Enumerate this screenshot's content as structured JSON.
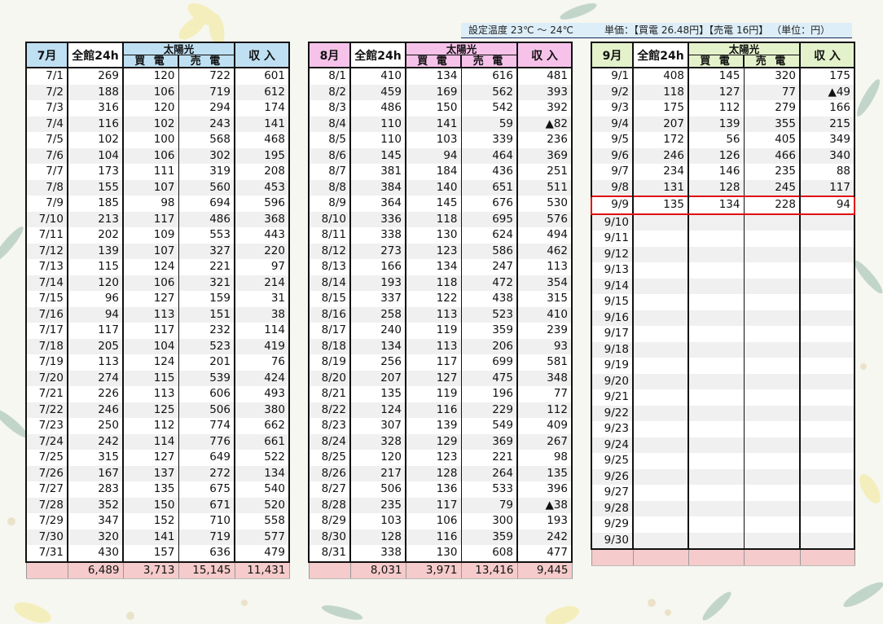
{
  "note": {
    "temp": "設定温度 23℃ ～ 24℃",
    "price": "単価：【買電 26.48円】【売電 16円】 （単位：円）"
  },
  "headers": {
    "all": "全館24h",
    "solar": "太陽光",
    "buy": "買 電",
    "sell": "売 電",
    "income": "収 入"
  },
  "colors": {
    "jul_header": "#bfe0f2",
    "aug_header": "#f6c2ea",
    "sep_header": "#e4f2cc",
    "total_row": "#f6cbcb",
    "highlight": "#e01010"
  },
  "highlight_row": {
    "month": "9月",
    "date": "9/9"
  },
  "months": [
    {
      "label": "7月",
      "rows": [
        [
          "7/1",
          "269",
          "120",
          "722",
          "601"
        ],
        [
          "7/2",
          "188",
          "106",
          "719",
          "612"
        ],
        [
          "7/3",
          "316",
          "120",
          "294",
          "174"
        ],
        [
          "7/4",
          "116",
          "102",
          "243",
          "141"
        ],
        [
          "7/5",
          "102",
          "100",
          "568",
          "468"
        ],
        [
          "7/6",
          "104",
          "106",
          "302",
          "195"
        ],
        [
          "7/7",
          "173",
          "111",
          "319",
          "208"
        ],
        [
          "7/8",
          "155",
          "107",
          "560",
          "453"
        ],
        [
          "7/9",
          "185",
          "98",
          "694",
          "596"
        ],
        [
          "7/10",
          "213",
          "117",
          "486",
          "368"
        ],
        [
          "7/11",
          "202",
          "109",
          "553",
          "443"
        ],
        [
          "7/12",
          "139",
          "107",
          "327",
          "220"
        ],
        [
          "7/13",
          "115",
          "124",
          "221",
          "97"
        ],
        [
          "7/14",
          "120",
          "106",
          "321",
          "214"
        ],
        [
          "7/15",
          "96",
          "127",
          "159",
          "31"
        ],
        [
          "7/16",
          "94",
          "113",
          "151",
          "38"
        ],
        [
          "7/17",
          "117",
          "117",
          "232",
          "114"
        ],
        [
          "7/18",
          "205",
          "104",
          "523",
          "419"
        ],
        [
          "7/19",
          "113",
          "124",
          "201",
          "76"
        ],
        [
          "7/20",
          "274",
          "115",
          "539",
          "424"
        ],
        [
          "7/21",
          "226",
          "113",
          "606",
          "493"
        ],
        [
          "7/22",
          "246",
          "125",
          "506",
          "380"
        ],
        [
          "7/23",
          "250",
          "112",
          "774",
          "662"
        ],
        [
          "7/24",
          "242",
          "114",
          "776",
          "661"
        ],
        [
          "7/25",
          "315",
          "127",
          "649",
          "522"
        ],
        [
          "7/26",
          "167",
          "137",
          "272",
          "134"
        ],
        [
          "7/27",
          "283",
          "135",
          "675",
          "540"
        ],
        [
          "7/28",
          "352",
          "150",
          "671",
          "520"
        ],
        [
          "7/29",
          "347",
          "152",
          "710",
          "558"
        ],
        [
          "7/30",
          "320",
          "141",
          "719",
          "577"
        ],
        [
          "7/31",
          "430",
          "157",
          "636",
          "479"
        ]
      ],
      "total": [
        "",
        "6,489",
        "3,713",
        "15,145",
        "11,431"
      ]
    },
    {
      "label": "8月",
      "rows": [
        [
          "8/1",
          "410",
          "134",
          "616",
          "481"
        ],
        [
          "8/2",
          "459",
          "169",
          "562",
          "393"
        ],
        [
          "8/3",
          "486",
          "150",
          "542",
          "392"
        ],
        [
          "8/4",
          "110",
          "141",
          "59",
          "▲82"
        ],
        [
          "8/5",
          "110",
          "103",
          "339",
          "236"
        ],
        [
          "8/6",
          "145",
          "94",
          "464",
          "369"
        ],
        [
          "8/7",
          "381",
          "184",
          "436",
          "251"
        ],
        [
          "8/8",
          "384",
          "140",
          "651",
          "511"
        ],
        [
          "8/9",
          "364",
          "145",
          "676",
          "530"
        ],
        [
          "8/10",
          "336",
          "118",
          "695",
          "576"
        ],
        [
          "8/11",
          "338",
          "130",
          "624",
          "494"
        ],
        [
          "8/12",
          "273",
          "123",
          "586",
          "462"
        ],
        [
          "8/13",
          "166",
          "134",
          "247",
          "113"
        ],
        [
          "8/14",
          "193",
          "118",
          "472",
          "354"
        ],
        [
          "8/15",
          "337",
          "122",
          "438",
          "315"
        ],
        [
          "8/16",
          "258",
          "113",
          "523",
          "410"
        ],
        [
          "8/17",
          "240",
          "119",
          "359",
          "239"
        ],
        [
          "8/18",
          "134",
          "113",
          "206",
          "93"
        ],
        [
          "8/19",
          "256",
          "117",
          "699",
          "581"
        ],
        [
          "8/20",
          "207",
          "127",
          "475",
          "348"
        ],
        [
          "8/21",
          "135",
          "119",
          "196",
          "77"
        ],
        [
          "8/22",
          "124",
          "116",
          "229",
          "112"
        ],
        [
          "8/23",
          "307",
          "139",
          "549",
          "409"
        ],
        [
          "8/24",
          "328",
          "129",
          "369",
          "267"
        ],
        [
          "8/25",
          "120",
          "123",
          "221",
          "98"
        ],
        [
          "8/26",
          "217",
          "128",
          "264",
          "135"
        ],
        [
          "8/27",
          "506",
          "136",
          "533",
          "396"
        ],
        [
          "8/28",
          "235",
          "117",
          "79",
          "▲38"
        ],
        [
          "8/29",
          "103",
          "106",
          "300",
          "193"
        ],
        [
          "8/30",
          "128",
          "116",
          "359",
          "242"
        ],
        [
          "8/31",
          "338",
          "130",
          "608",
          "477"
        ]
      ],
      "total": [
        "",
        "8,031",
        "3,971",
        "13,416",
        "9,445"
      ]
    },
    {
      "label": "9月",
      "rows": [
        [
          "9/1",
          "408",
          "145",
          "320",
          "175"
        ],
        [
          "9/2",
          "118",
          "127",
          "77",
          "▲49"
        ],
        [
          "9/3",
          "175",
          "112",
          "279",
          "166"
        ],
        [
          "9/4",
          "207",
          "139",
          "355",
          "215"
        ],
        [
          "9/5",
          "172",
          "56",
          "405",
          "349"
        ],
        [
          "9/6",
          "246",
          "126",
          "466",
          "340"
        ],
        [
          "9/7",
          "234",
          "146",
          "235",
          "88"
        ],
        [
          "9/8",
          "131",
          "128",
          "245",
          "117"
        ],
        [
          "9/9",
          "135",
          "134",
          "228",
          "94"
        ],
        [
          "9/10",
          "",
          "",
          "",
          ""
        ],
        [
          "9/11",
          "",
          "",
          "",
          ""
        ],
        [
          "9/12",
          "",
          "",
          "",
          ""
        ],
        [
          "9/13",
          "",
          "",
          "",
          ""
        ],
        [
          "9/14",
          "",
          "",
          "",
          ""
        ],
        [
          "9/15",
          "",
          "",
          "",
          ""
        ],
        [
          "9/16",
          "",
          "",
          "",
          ""
        ],
        [
          "9/17",
          "",
          "",
          "",
          ""
        ],
        [
          "9/18",
          "",
          "",
          "",
          ""
        ],
        [
          "9/19",
          "",
          "",
          "",
          ""
        ],
        [
          "9/20",
          "",
          "",
          "",
          ""
        ],
        [
          "9/21",
          "",
          "",
          "",
          ""
        ],
        [
          "9/22",
          "",
          "",
          "",
          ""
        ],
        [
          "9/23",
          "",
          "",
          "",
          ""
        ],
        [
          "9/24",
          "",
          "",
          "",
          ""
        ],
        [
          "9/25",
          "",
          "",
          "",
          ""
        ],
        [
          "9/26",
          "",
          "",
          "",
          ""
        ],
        [
          "9/27",
          "",
          "",
          "",
          ""
        ],
        [
          "9/28",
          "",
          "",
          "",
          ""
        ],
        [
          "9/29",
          "",
          "",
          "",
          ""
        ],
        [
          "9/30",
          "",
          "",
          "",
          ""
        ]
      ],
      "total": [
        "",
        "",
        "",
        "",
        ""
      ]
    }
  ]
}
